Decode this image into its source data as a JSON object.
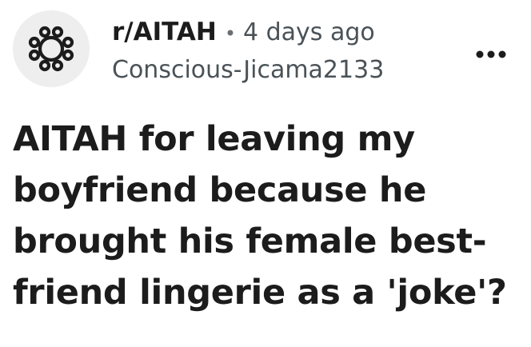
{
  "post": {
    "subreddit": "r/AITAH",
    "separator": "•",
    "time_ago": "4 days ago",
    "author": "Conscious-Jicama2133",
    "title": "AITAH for leaving my boyfriend because he brought his female best-friend lingerie as a 'joke'?",
    "avatar_icon": "subreddit-community-icon",
    "more_icon": "more-options-icon"
  },
  "colors": {
    "text_primary": "#1c1c1c",
    "text_secondary": "#4a5257",
    "avatar_background": "#eeeeee"
  }
}
